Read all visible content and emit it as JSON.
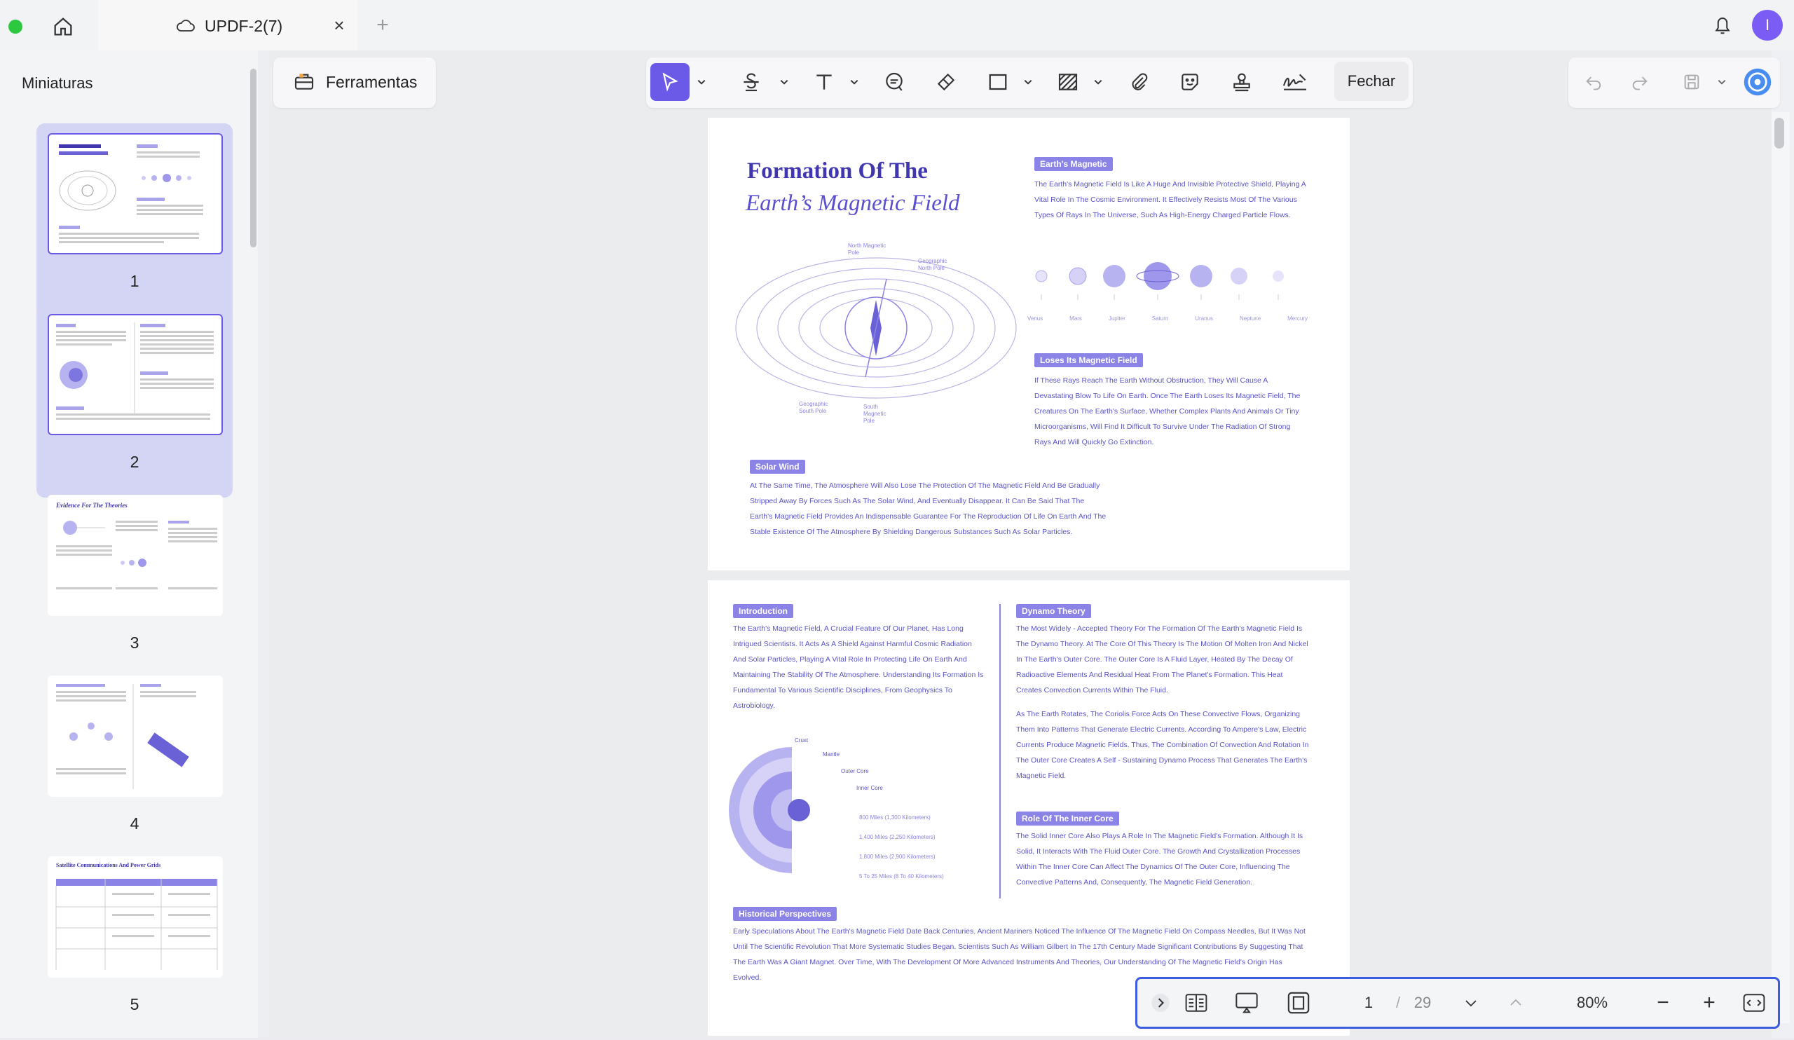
{
  "window": {
    "tab_title": "UPDF-2(7)",
    "user_initial": "I"
  },
  "sidebar": {
    "title": "Miniaturas",
    "thumbnails": [
      {
        "num": "1"
      },
      {
        "num": "2"
      },
      {
        "num": "3"
      },
      {
        "num": "4"
      },
      {
        "num": "5"
      }
    ]
  },
  "toolbar": {
    "tools_label": "Ferramentas",
    "close_label": "Fechar"
  },
  "page1": {
    "title_line1": "Formation Of The",
    "title_line2": "Earth’s Magnetic Field",
    "earth_magnetic_heading": "Earth's Magnetic",
    "earth_magnetic_text": "The Earth's Magnetic Field Is Like A Huge And Invisible Protective Shield, Playing A Vital Role In The Cosmic Environment. It Effectively Resists Most Of The Various Types Of Rays In The Universe, Such As High-Energy Charged Particle Flows.",
    "planets": [
      "Venus",
      "Mars",
      "Jupiter",
      "Saturn",
      "Uranus",
      "Neptune",
      "Mercury"
    ],
    "diagram_labels": {
      "north_magnetic": "North Magnetic Pole",
      "geo_north": "Geographic North Pole",
      "geo_south": "Geographic South Pole",
      "south_magnetic": "South Magnetic Pole"
    },
    "loses_heading": "Loses Its Magnetic Field",
    "loses_text": "If These Rays Reach The Earth Without Obstruction, They Will Cause A Devastating Blow To Life On Earth. Once The Earth Loses Its Magnetic Field, The Creatures On The Earth's Surface, Whether Complex Plants And Animals Or Tiny Microorganisms, Will Find It Difficult To Survive Under The Radiation Of Strong Rays And Will Quickly Go Extinction.",
    "solar_heading": "Solar Wind",
    "solar_text": "At The Same Time, The Atmosphere Will Also Lose The Protection Of The Magnetic Field And Be Gradually Stripped Away By Forces Such As The Solar Wind, And Eventually Disappear. It Can Be Said That The Earth's Magnetic Field Provides An Indispensable Guarantee For The Reproduction Of Life On Earth And The Stable Existence Of The Atmosphere By Shielding Dangerous Substances Such As Solar Particles."
  },
  "page2": {
    "intro_heading": "Introduction",
    "intro_text": "The Earth's Magnetic Field, A Crucial Feature Of Our Planet, Has Long Intrigued Scientists. It Acts As A Shield Against Harmful Cosmic Radiation And Solar Particles, Playing A Vital Role In Protecting Life On Earth And Maintaining The Stability Of The Atmosphere. Understanding Its Formation Is Fundamental To Various Scientific Disciplines, From Geophysics To Astrobiology.",
    "core_labels": [
      "Crust",
      "Mantle",
      "Outer Core",
      "Inner Core"
    ],
    "depth_labels": [
      "800 Miles (1,300 Kilometers)",
      "1,400 Miles (2,250 Kilometers)",
      "1,800 Miles (2,900 Kilometers)",
      "5 To 25 Miles (8 To 40 Kilometers)"
    ],
    "dynamo_heading": "Dynamo Theory",
    "dynamo_text": "The Most Widely - Accepted Theory For The Formation Of The Earth's Magnetic Field Is The Dynamo Theory. At The Core Of This Theory Is The Motion Of Molten Iron And Nickel In The Earth's Outer Core. The Outer Core Is A Fluid Layer, Heated By The Decay Of Radioactive Elements And Residual Heat From The Planet's Formation. This Heat Creates Convection Currents Within The Fluid.",
    "dynamo_text2": "As The Earth Rotates, The Coriolis Force Acts On These Convective Flows, Organizing Them Into Patterns That Generate Electric Currents. According To Ampere's Law, Electric Currents Produce Magnetic Fields. Thus, The Combination Of Convection And Rotation In The Outer Core Creates A Self - Sustaining Dynamo Process That Generates The Earth's Magnetic Field.",
    "inner_heading": "Role Of The Inner Core",
    "inner_text": "The Solid Inner Core Also Plays A Role In The Magnetic Field's Formation. Although It Is Solid, It Interacts With The Fluid Outer Core. The Growth And Crystallization Processes Within The Inner Core Can Affect The Dynamics Of The Outer Core, Influencing The Convective Patterns And, Consequently, The Magnetic Field Generation.",
    "hist_heading": "Historical Perspectives",
    "hist_text": "Early Speculations About The Earth's Magnetic Field Date Back Centuries. Ancient Mariners Noticed The Influence Of The Magnetic Field On Compass Needles, But It Was Not Until The Scientific Revolution That More Systematic Studies Began. Scientists Such As William Gilbert In The 17th Century Made Significant Contributions By Suggesting That The Earth Was A Giant Magnet. Over Time, With The Development Of More Advanced Instruments And Theories, Our Understanding Of The Magnetic Field's Origin Has Evolved."
  },
  "thumb3": {
    "title": "Evidence For The Theories"
  },
  "thumb5": {
    "title": "Satellite Communications And Power Grids"
  },
  "pager": {
    "current": "1",
    "separator": "/",
    "total": "29",
    "zoom": "80%"
  },
  "colors": {
    "accent": "#6b59e8",
    "page_text": "#5a55c8",
    "heading_bg": "#8b83e6",
    "title": "#3f36b0"
  }
}
